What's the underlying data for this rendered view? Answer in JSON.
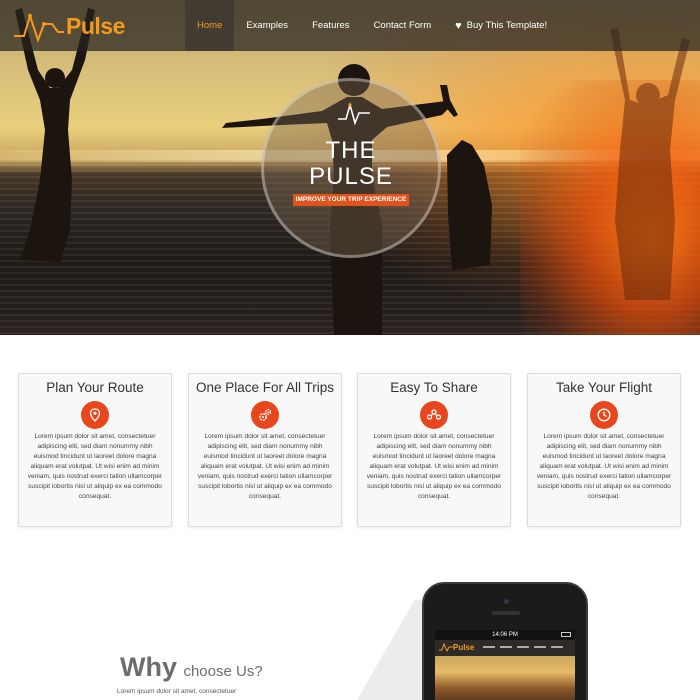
{
  "brand": {
    "name": "Pulse",
    "accent": "#f39a1e",
    "badge_color": "#e0531c",
    "icon_color": "#e8471d"
  },
  "nav": {
    "items": [
      {
        "label": "Home",
        "active": true
      },
      {
        "label": "Examples",
        "active": false
      },
      {
        "label": "Features",
        "active": false
      },
      {
        "label": "Contact Form",
        "active": false
      },
      {
        "label": "Buy This Template!",
        "active": false,
        "icon": "heart-icon"
      }
    ]
  },
  "hero": {
    "title_line1": "THE",
    "title_line2": "PULSE",
    "tagline": "IMPROVE YOUR TRIP EXPERIENCE"
  },
  "features": [
    {
      "title": "Plan Your Route",
      "icon": "map-pin-icon",
      "text": "Lorem ipsum dolor sit amet, consectetuer adipiscing elit, sed diam nonummy nibh euismod tincidunt ut laoreet dolore magna aliquam erat volutpat. Ut wisi enim ad minim veniam, quis nostrud exerci tation ullamcorper suscipit lobortis nisl ut aliquip ex ea commodo consequat."
    },
    {
      "title": "One Place For All Trips",
      "icon": "gears-icon",
      "text": "Lorem ipsum dolor sit amet, consectetuer adipiscing elit, sed diam nonummy nibh euismod tincidunt ut laoreet dolore magna aliquam erat volutpat. Ut wisi enim ad minim veniam, quis nostrud exerci tation ullamcorper suscipit lobortis nisl ut aliquip ex ea commodo consequat."
    },
    {
      "title": "Easy To Share",
      "icon": "share-network-icon",
      "text": "Lorem ipsum dolor sit amet, consectetuer adipiscing elit, sed diam nonummy nibh euismod tincidunt ut laoreet dolore magna aliquam erat volutpat. Ut wisi enim ad minim veniam, quis nostrud exerci tation ullamcorper suscipit lobortis nisl ut aliquip ex ea commodo consequat."
    },
    {
      "title": "Take Your Flight",
      "icon": "clock-icon",
      "text": "Lorem ipsum dolor sit amet, consectetuer adipiscing elit, sed diam nonummy nibh euismod tincidunt ut laoreet dolore magna aliquam erat volutpat. Ut wisi enim ad minim veniam, quis nostrud exerci tation ullamcorper suscipit lobortis nisl ut aliquip ex ea commodo consequat."
    }
  ],
  "why": {
    "big": "Why",
    "small": "choose Us?",
    "text": "Lorem ipsum dolor sit amet, consectetuer"
  },
  "phone": {
    "time": "14:06 PM",
    "screen_brand": "Pulse"
  }
}
